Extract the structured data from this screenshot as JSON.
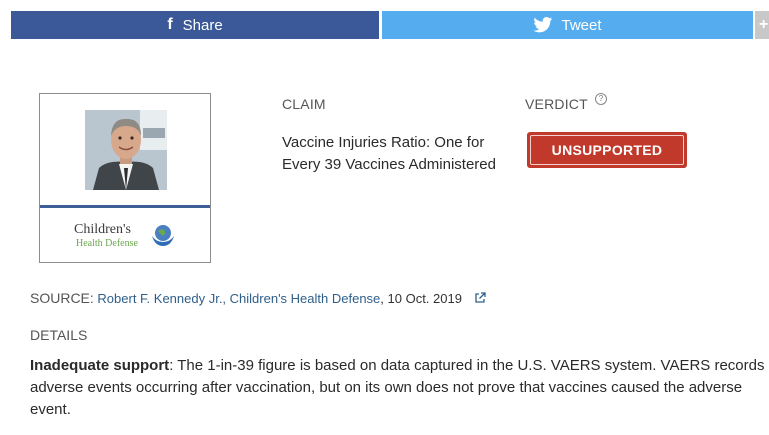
{
  "share_bar": {
    "share_label": "Share",
    "share_icon": "facebook-icon",
    "tweet_label": "Tweet",
    "tweet_icon": "twitter-bird-icon",
    "more_icon": "plus-icon",
    "share_color": "#3b5998",
    "tweet_color": "#55acee"
  },
  "card": {
    "photo": "portrait-photo",
    "logo_line1": "Children's",
    "logo_line2": "Health Defense",
    "logo_icon": "globe-hands-icon"
  },
  "claim": {
    "label": "CLAIM",
    "text": "Vaccine Injuries Ratio: One for Every 39 Vaccines Administered"
  },
  "verdict": {
    "label": "VERDICT",
    "help_icon": "question-circle-icon",
    "badge": "UNSUPPORTED",
    "badge_color": "#c0392b"
  },
  "source": {
    "label": "SOURCE:",
    "link_text": "Robert F. Kennedy Jr., Children's Health Defense",
    "date": ", 10 Oct. 2019",
    "link_icon": "external-link-icon"
  },
  "details": {
    "label": "DETAILS",
    "lead": "Inadequate support",
    "text": ": The 1-in-39 figure is based on data captured in the U.S. VAERS system. VAERS records adverse events occurring after vaccination, but on its own does not prove that vaccines caused the adverse event."
  }
}
